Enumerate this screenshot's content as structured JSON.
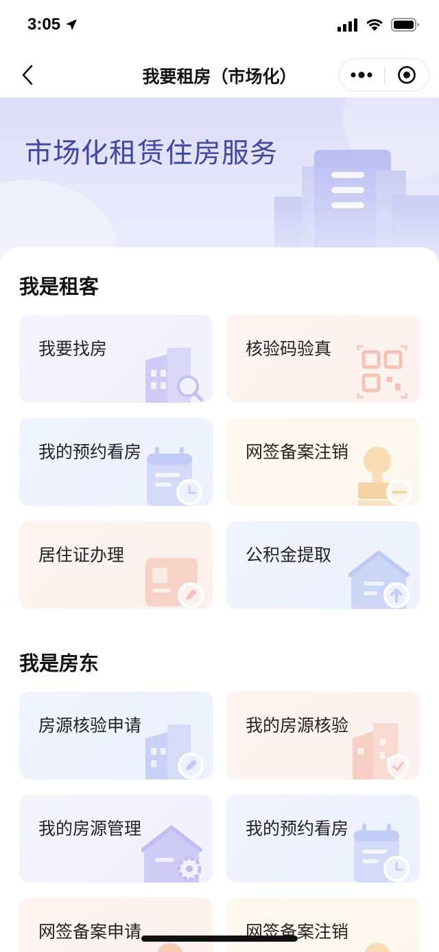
{
  "status_bar": {
    "time": "3:05"
  },
  "nav": {
    "title": "我要租房（市场化）",
    "more_icon": "more-dots-icon",
    "close_icon": "target-circle-icon"
  },
  "banner": {
    "title": "市场化租赁住房服务"
  },
  "tenant": {
    "title": "我是租客",
    "tiles": [
      {
        "label": "我要找房",
        "icon": "building-search-icon",
        "theme": "purple"
      },
      {
        "label": "核验码验真",
        "icon": "qr-code-icon",
        "theme": "pink"
      },
      {
        "label": "我的预约看房",
        "icon": "calendar-clock-icon",
        "theme": "blue"
      },
      {
        "label": "网签备案注销",
        "icon": "stamp-minus-icon",
        "theme": "yellow"
      },
      {
        "label": "居住证办理",
        "icon": "card-edit-icon",
        "theme": "pink"
      },
      {
        "label": "公积金提取",
        "icon": "house-upload-icon",
        "theme": "blue"
      }
    ]
  },
  "landlord": {
    "title": "我是房东",
    "tiles": [
      {
        "label": "房源核验申请",
        "icon": "building-edit-icon",
        "theme": "blue"
      },
      {
        "label": "我的房源核验",
        "icon": "building-shield-icon",
        "theme": "pink"
      },
      {
        "label": "我的房源管理",
        "icon": "house-gear-icon",
        "theme": "purple"
      },
      {
        "label": "我的预约看房",
        "icon": "calendar-clock-icon",
        "theme": "blue"
      },
      {
        "label": "网签备案申请",
        "icon": "stamp-icon",
        "theme": "pink"
      },
      {
        "label": "网签备案注销",
        "icon": "stamp-minus-icon",
        "theme": "yellow"
      }
    ]
  },
  "colors": {
    "banner_title": "#3e47a8",
    "purple_icon": "#c9c6f3",
    "pink_icon": "#f6cfc4",
    "blue_icon": "#cdd6f6",
    "yellow_icon": "#f7ddb6"
  }
}
